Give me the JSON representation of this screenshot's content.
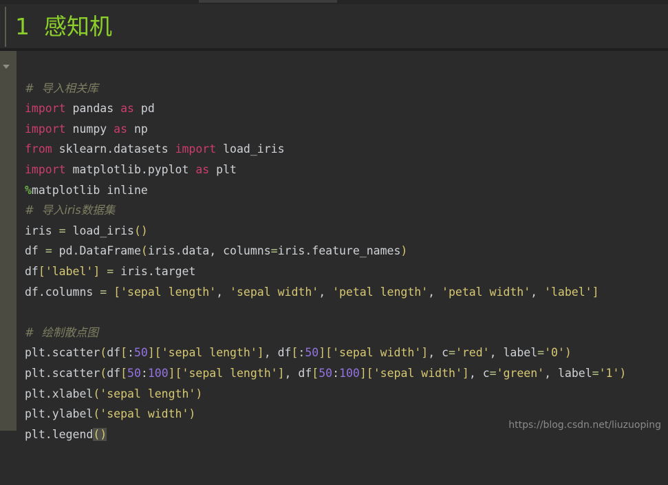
{
  "window": {
    "background_color": "#2b2b2b",
    "top_tab_color": "#3d3d3d"
  },
  "heading": {
    "text": "1  感知机",
    "color": "#8ccf2a"
  },
  "gutter": {
    "collapse_icon": "chevron-down-icon",
    "color": "#4b4b42"
  },
  "code": {
    "language": "python",
    "lines": [
      "# 导入相关库",
      "import pandas as pd",
      "import numpy as np",
      "from sklearn.datasets import load_iris",
      "import matplotlib.pyplot as plt",
      "%matplotlib inline",
      "# 导入iris数据集",
      "iris = load_iris()",
      "df = pd.DataFrame(iris.data, columns=iris.feature_names)",
      "df['label'] = iris.target",
      "df.columns = ['sepal length', 'sepal width', 'petal length', 'petal width', 'label']",
      "",
      "# 绘制散点图",
      "plt.scatter(df[:50]['sepal length'], df[:50]['sepal width'], c='red', label='0')",
      "plt.scatter(df[50:100]['sepal length'], df[50:100]['sepal width'], c='green', label='1')",
      "plt.xlabel('sepal length')",
      "plt.ylabel('sepal width')",
      "plt.legend()"
    ],
    "colors": {
      "keyword": "#cc3d6c",
      "string": "#d7c873",
      "number": "#9473e0",
      "comment": "#7f7f63",
      "operator": "#b8cb8a",
      "identifier": "#cfd2d6",
      "magic": "#6ab04c",
      "bracket_match_highlight": "#4e4e48"
    }
  },
  "watermark": {
    "text": "https://blog.csdn.net/liuzuoping"
  }
}
